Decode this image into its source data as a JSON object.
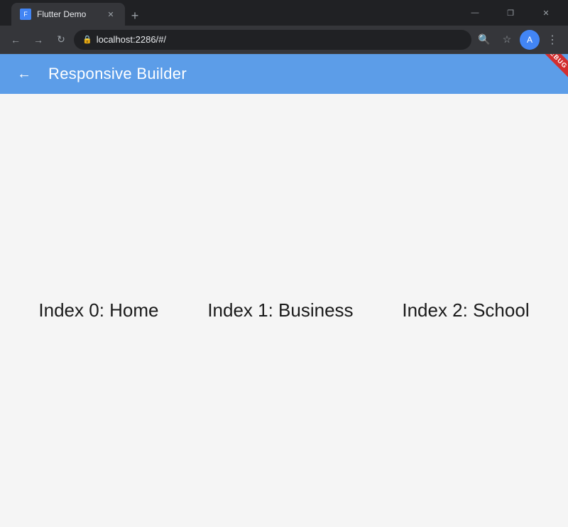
{
  "browser": {
    "tab_title": "Flutter Demo",
    "url": "localhost:2286/#/",
    "new_tab_label": "+",
    "minimize_icon": "—",
    "restore_icon": "❐",
    "close_icon": "✕",
    "back_icon": "←",
    "forward_icon": "→",
    "refresh_icon": "↻",
    "search_icon": "🔍",
    "star_icon": "☆",
    "profile_initial": "A",
    "menu_icon": "⋮"
  },
  "app": {
    "title": "Responsive Builder",
    "back_icon": "←",
    "debug_label": "DEBUG",
    "content_items": [
      {
        "label": "Index 0: Home"
      },
      {
        "label": "Index 1: Business"
      },
      {
        "label": "Index 2: School"
      }
    ]
  },
  "colors": {
    "app_bar": "#5b94e0",
    "content_bg": "#f4f4f4"
  }
}
